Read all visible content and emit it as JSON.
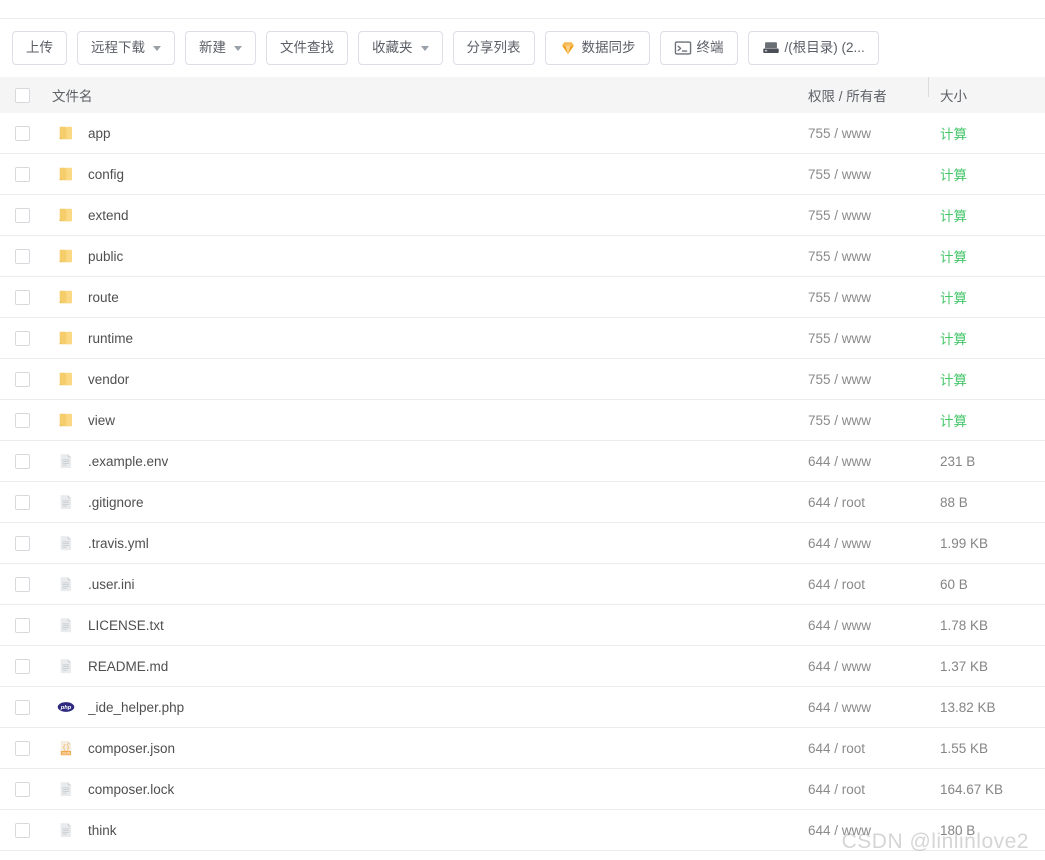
{
  "toolbar": {
    "buttons": [
      {
        "label": "上传",
        "icon": null,
        "caret": false
      },
      {
        "label": "远程下载",
        "icon": null,
        "caret": true
      },
      {
        "label": "新建",
        "icon": null,
        "caret": true
      },
      {
        "label": "文件查找",
        "icon": null,
        "caret": false
      },
      {
        "label": "收藏夹",
        "icon": null,
        "caret": true
      },
      {
        "label": "分享列表",
        "icon": null,
        "caret": false
      },
      {
        "label": "数据同步",
        "icon": "gem-icon",
        "caret": false
      },
      {
        "label": "终端",
        "icon": "terminal-icon",
        "caret": false
      },
      {
        "label": "/(根目录) (2...",
        "icon": "disk-icon",
        "caret": false
      }
    ]
  },
  "table": {
    "headers": {
      "name": "文件名",
      "permission": "权限 / 所有者",
      "size": "大小"
    },
    "rows": [
      {
        "name": "app",
        "icon": "folder-icon",
        "permission": "755 / www",
        "size": "计算",
        "size_type": "calc"
      },
      {
        "name": "config",
        "icon": "folder-icon",
        "permission": "755 / www",
        "size": "计算",
        "size_type": "calc"
      },
      {
        "name": "extend",
        "icon": "folder-icon",
        "permission": "755 / www",
        "size": "计算",
        "size_type": "calc"
      },
      {
        "name": "public",
        "icon": "folder-icon",
        "permission": "755 / www",
        "size": "计算",
        "size_type": "calc"
      },
      {
        "name": "route",
        "icon": "folder-icon",
        "permission": "755 / www",
        "size": "计算",
        "size_type": "calc"
      },
      {
        "name": "runtime",
        "icon": "folder-icon",
        "permission": "755 / www",
        "size": "计算",
        "size_type": "calc"
      },
      {
        "name": "vendor",
        "icon": "folder-icon",
        "permission": "755 / www",
        "size": "计算",
        "size_type": "calc"
      },
      {
        "name": "view",
        "icon": "folder-icon",
        "permission": "755 / www",
        "size": "计算",
        "size_type": "calc"
      },
      {
        "name": ".example.env",
        "icon": "file-icon",
        "permission": "644 / www",
        "size": "231 B",
        "size_type": "size"
      },
      {
        "name": ".gitignore",
        "icon": "file-icon",
        "permission": "644 / root",
        "size": "88 B",
        "size_type": "size"
      },
      {
        "name": ".travis.yml",
        "icon": "file-icon",
        "permission": "644 / www",
        "size": "1.99 KB",
        "size_type": "size"
      },
      {
        "name": ".user.ini",
        "icon": "file-icon",
        "permission": "644 / root",
        "size": "60 B",
        "size_type": "size"
      },
      {
        "name": "LICENSE.txt",
        "icon": "file-icon",
        "permission": "644 / www",
        "size": "1.78 KB",
        "size_type": "size"
      },
      {
        "name": "README.md",
        "icon": "file-icon",
        "permission": "644 / www",
        "size": "1.37 KB",
        "size_type": "size"
      },
      {
        "name": "_ide_helper.php",
        "icon": "php-icon",
        "permission": "644 / www",
        "size": "13.82 KB",
        "size_type": "size"
      },
      {
        "name": "composer.json",
        "icon": "json-icon",
        "permission": "644 / root",
        "size": "1.55 KB",
        "size_type": "size"
      },
      {
        "name": "composer.lock",
        "icon": "file-icon",
        "permission": "644 / root",
        "size": "164.67 KB",
        "size_type": "size"
      },
      {
        "name": "think",
        "icon": "file-icon",
        "permission": "644 / www",
        "size": "180 B",
        "size_type": "size"
      }
    ]
  },
  "watermark": "CSDN @linlinlove2",
  "colors": {
    "folder": "#f5cd6b",
    "calc_green": "#47c66b",
    "gem_orange": "#f0a020",
    "php_blue": "#2e2a7f",
    "json_orange": "#f0a84b",
    "header_bg": "#f5f5f5"
  }
}
